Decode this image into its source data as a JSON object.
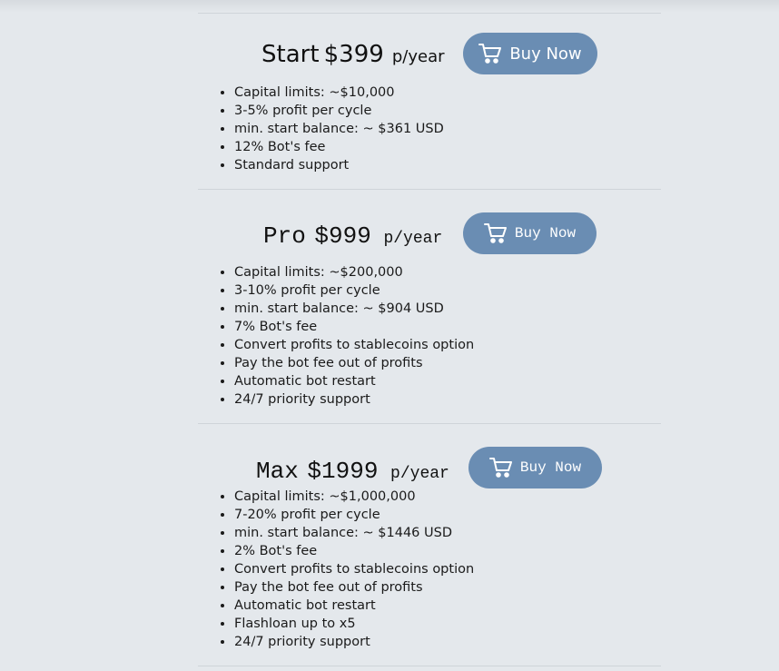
{
  "plans": [
    {
      "name": "Start",
      "price": "$399",
      "period": "p/year",
      "button_label": "Buy Now",
      "features": [
        "Capital limits: ~$10,000",
        "3-5% profit per cycle",
        "min. start balance: ~ $361 USD",
        "12% Bot's fee",
        "Standard support"
      ]
    },
    {
      "name": "Pro",
      "price": "$999",
      "period": "p/year",
      "button_label": "Buy Now",
      "features": [
        "Capital limits: ~$200,000",
        "3-10% profit per cycle",
        "min. start balance: ~ $904 USD",
        "7% Bot's fee",
        "Convert profits to stablecoins option",
        "Pay the bot fee out of profits",
        "Automatic bot restart",
        "24/7 priority support"
      ]
    },
    {
      "name": "Max",
      "price": "$1999",
      "period": "p/year",
      "button_label": "Buy Now",
      "features": [
        "Capital limits: ~$1,000,000",
        "7-20% profit per cycle",
        "min. start balance: ~ $1446 USD",
        "2% Bot's fee",
        "Convert profits to stablecoins option",
        "Pay the bot fee out of profits",
        "Automatic bot restart",
        "Flashloan up to x5",
        "24/7 priority support"
      ]
    }
  ],
  "colors": {
    "button": "#6a8db3",
    "background": "#e4e8ec"
  },
  "icons": [
    "cart-icon"
  ]
}
